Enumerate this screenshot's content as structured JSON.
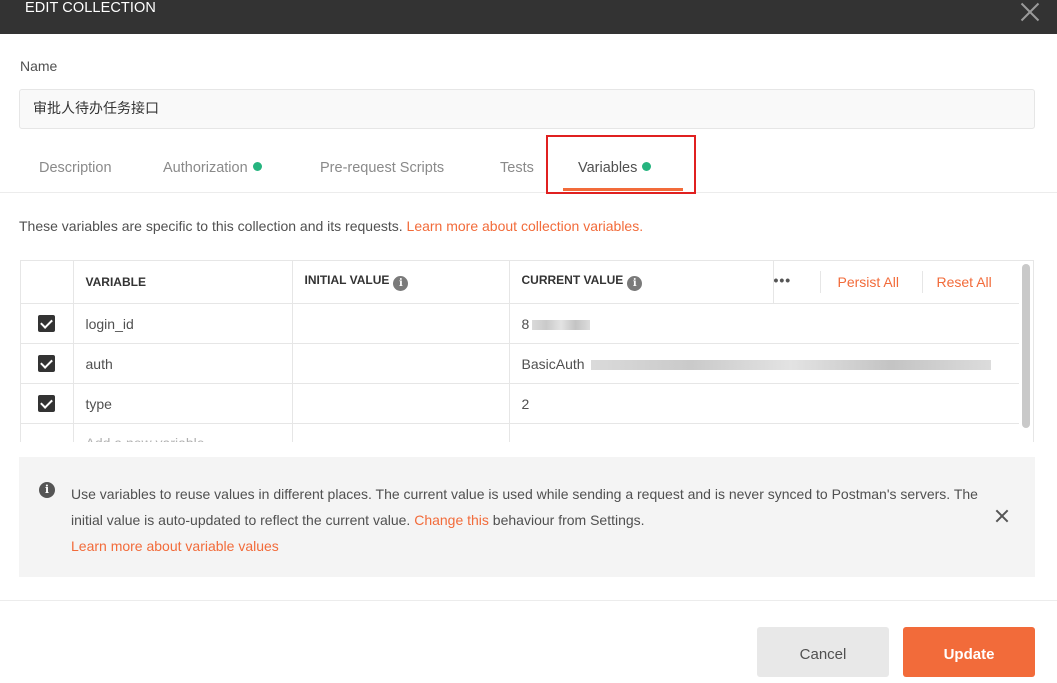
{
  "dialog": {
    "title": "EDIT COLLECTION"
  },
  "name": {
    "label": "Name",
    "value": "审批人待办任务接口"
  },
  "tabs": [
    {
      "label": "Description"
    },
    {
      "label": "Authorization",
      "has_dot": true
    },
    {
      "label": "Pre-request Scripts"
    },
    {
      "label": "Tests"
    },
    {
      "label": "Variables",
      "has_dot": true,
      "active": true
    }
  ],
  "intro": {
    "text": "These variables are specific to this collection and its requests. ",
    "link": "Learn more about collection variables."
  },
  "table": {
    "headers": {
      "variable": "VARIABLE",
      "initial": "INITIAL VALUE",
      "current": "CURRENT VALUE"
    },
    "actions": {
      "more": "•••",
      "persist_all": "Persist All",
      "reset_all": "Reset All"
    },
    "rows": [
      {
        "checked": true,
        "variable": "login_id",
        "initial": "",
        "current": "8"
      },
      {
        "checked": true,
        "variable": "auth",
        "initial": "",
        "current": "BasicAuth"
      },
      {
        "checked": true,
        "variable": "type",
        "initial": "",
        "current": "2"
      }
    ],
    "new_placeholder": "Add a new variable"
  },
  "notice": {
    "text1": "Use variables to reuse values in different places. The current value is used while sending a request and is never synced to Postman's servers. The initial value is auto-updated to reflect the current value. ",
    "link1": "Change this",
    "text2": " behaviour from Settings.",
    "link2": "Learn more about variable values"
  },
  "footer": {
    "cancel": "Cancel",
    "update": "Update"
  },
  "colors": {
    "accent": "#f26b3a",
    "dot": "#26b47f",
    "highlight_box": "#e02020",
    "titlebar": "#333333"
  }
}
